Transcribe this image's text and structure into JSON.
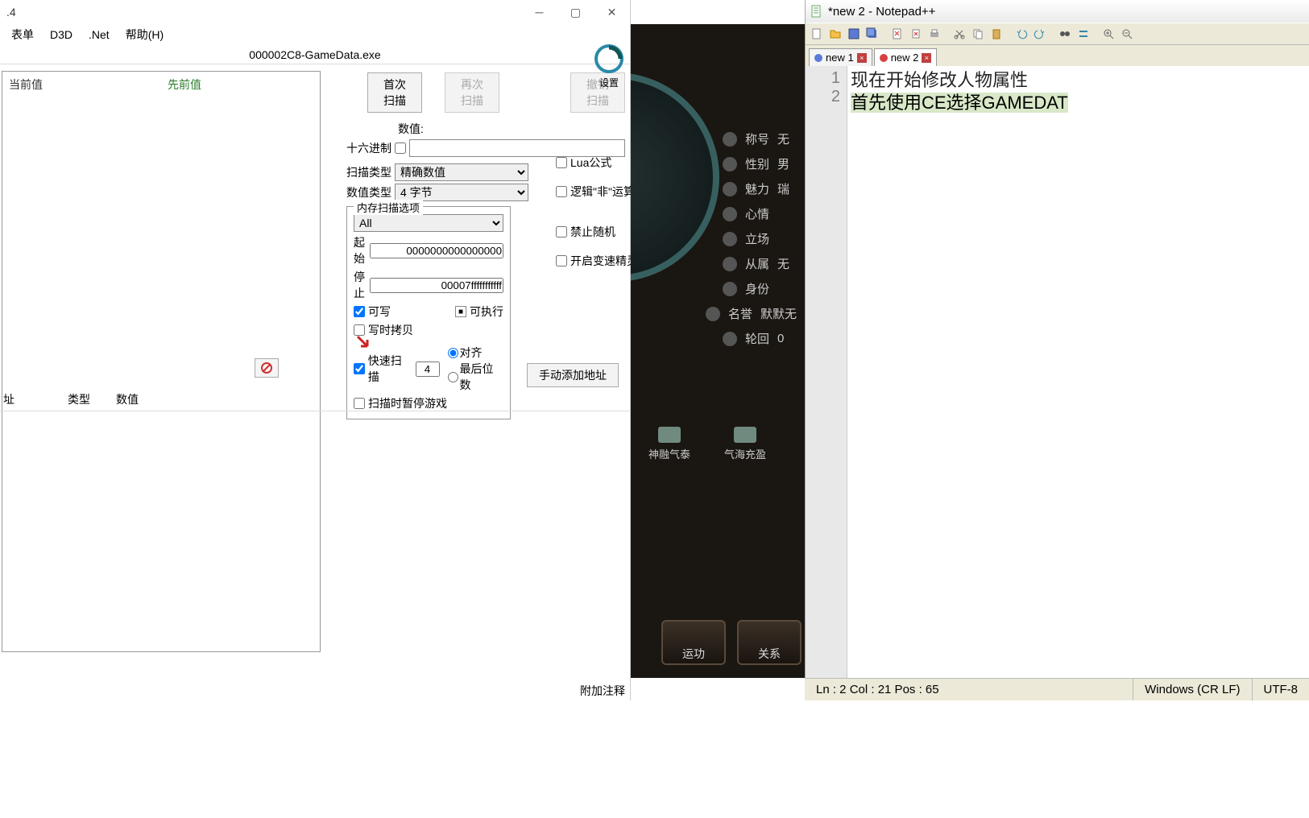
{
  "ce": {
    "version": ".4",
    "menu": {
      "table": "表单",
      "d3d": "D3D",
      "net": ".Net",
      "help": "帮助(H)"
    },
    "process": "000002C8-GameData.exe",
    "settings_label": "设置",
    "results": {
      "current": "当前值",
      "previous": "先前值"
    },
    "scan": {
      "first": "首次扫描",
      "next": "再次扫描",
      "undo": "撤销扫描",
      "value_label": "数值:",
      "hex": "十六进制",
      "scan_type_label": "扫描类型",
      "scan_type_value": "精确数值",
      "value_type_label": "数值类型",
      "value_type_value": "4 字节",
      "mem_legend": "内存扫描选项",
      "mem_all": "All",
      "start_label": "起始",
      "start_value": "0000000000000000",
      "stop_label": "停止",
      "stop_value": "00007fffffffffff",
      "writable": "可写",
      "executable": "可执行",
      "copyonwrite": "写时拷贝",
      "fastscan": "快速扫描",
      "fast_value": "4",
      "aligned": "对齐",
      "lastdigits": "最后位数",
      "pause": "扫描时暂停游戏",
      "lua": "Lua公式",
      "not": "逻辑\"非\"运算",
      "norandom": "禁止随机",
      "speedhack": "开启变速精灵"
    },
    "manual_add": "手动添加地址",
    "table_cols": {
      "addr": "址",
      "type": "类型",
      "value": "数值"
    },
    "addcomment": "附加注释"
  },
  "game": {
    "stats": [
      {
        "label": "称号",
        "value": "无"
      },
      {
        "label": "性别",
        "value": "男"
      },
      {
        "label": "魅力",
        "value": "瑞"
      },
      {
        "label": "心情",
        "value": ""
      },
      {
        "label": "立场",
        "value": ""
      },
      {
        "label": "从属",
        "value": "无"
      },
      {
        "label": "身份",
        "value": ""
      },
      {
        "label": "名誉",
        "value": "默默无"
      },
      {
        "label": "轮回",
        "value": "0"
      }
    ],
    "buffs": [
      "神融气泰",
      "气海充盈"
    ],
    "btns": [
      "运功",
      "关系"
    ]
  },
  "npp": {
    "title": "*new 2 - Notepad++",
    "tabs": [
      {
        "name": "new 1"
      },
      {
        "name": "new 2"
      }
    ],
    "lines": [
      "现在开始修改人物属性",
      "首先使用CE选择GAMEDAT"
    ],
    "status": {
      "pos": "Ln : 2    Col : 21    Pos : 65",
      "eol": "Windows (CR LF)",
      "enc": "UTF-8"
    }
  }
}
